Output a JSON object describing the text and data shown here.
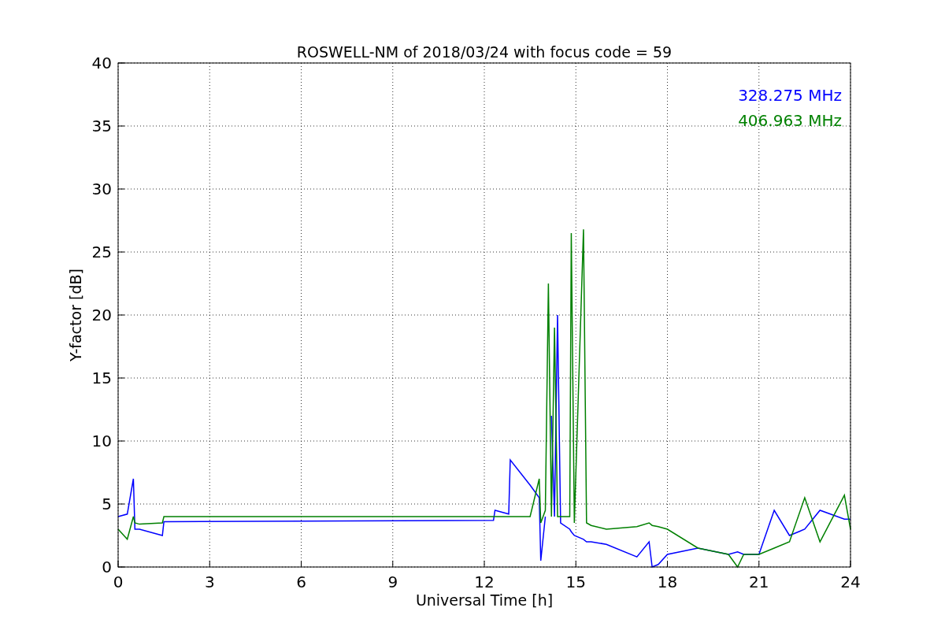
{
  "chart_data": {
    "type": "line",
    "title": "ROSWELL-NM of 2018/03/24 with focus code = 59",
    "xlabel": "Universal Time [h]",
    "ylabel": "Y-factor [dB]",
    "grid": true,
    "xlim": [
      0,
      24
    ],
    "ylim": [
      0,
      40
    ],
    "xticks": [
      0,
      3,
      6,
      9,
      12,
      15,
      18,
      21,
      24
    ],
    "yticks": [
      0,
      5,
      10,
      15,
      20,
      25,
      30,
      35,
      40
    ],
    "x": [
      0,
      0.3,
      0.5,
      0.55,
      0.7,
      1.45,
      1.5,
      12.3,
      12.35,
      12.8,
      12.85,
      13.5,
      13.8,
      13.85,
      14,
      14.1,
      14.2,
      14.3,
      14.4,
      14.5,
      14.8,
      14.85,
      14.95,
      15.25,
      15.35,
      15.5,
      16,
      17,
      17.4,
      17.5,
      17.7,
      18,
      19,
      20,
      20.3,
      20.5,
      21,
      21.5,
      22,
      22.5,
      23,
      23.8,
      24
    ],
    "series": [
      {
        "name": "328.275 MHz",
        "color": "#0000ff",
        "values": [
          4,
          4.2,
          7,
          3,
          3,
          2.5,
          3.6,
          3.7,
          4.5,
          4.2,
          8.5,
          6.5,
          5.5,
          0.5,
          4,
          null,
          12,
          4,
          20,
          3.5,
          3,
          2.8,
          2.5,
          2.2,
          2,
          2,
          1.8,
          0.8,
          2,
          0,
          0.2,
          1,
          1.5,
          1,
          1.2,
          1,
          1,
          4.5,
          2.5,
          3,
          4.5,
          3.8,
          3.8
        ]
      },
      {
        "name": "406.963 MHz",
        "color": "#008000",
        "values": [
          3,
          2.2,
          4,
          3.5,
          3.4,
          3.5,
          4,
          4,
          4,
          4,
          4,
          4,
          7,
          3.5,
          4.5,
          22.5,
          4,
          19,
          4,
          4,
          4,
          26.5,
          3.5,
          26.8,
          3.5,
          3.3,
          3,
          3.2,
          3.5,
          3.3,
          3.2,
          3,
          1.5,
          1,
          0,
          1,
          1,
          1.5,
          2,
          5.5,
          2,
          5.7,
          3
        ]
      }
    ]
  }
}
